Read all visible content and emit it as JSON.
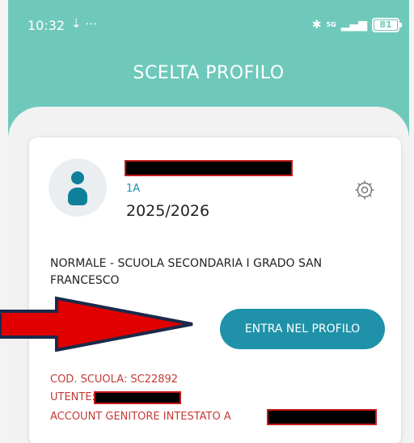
{
  "status_bar": {
    "time": "10:32",
    "network": "5G",
    "battery": "81"
  },
  "header": {
    "title": "SCELTA PROFILO"
  },
  "profile": {
    "class": "1A",
    "year": "2025/2026",
    "school": "NORMALE - SCUOLA SECONDARIA I GRADO SAN FRANCESCO",
    "enter_label": "ENTRA NEL PROFILO",
    "school_code": "COD. SCUOLA: SC22892",
    "user_label": "UTENTE:",
    "account_label": "ACCOUNT GENITORE INTESTATO A"
  },
  "colors": {
    "header": "#6fc9bb",
    "accent": "#1f92a9",
    "info_text": "#c43b37",
    "arrow": "#e00000"
  },
  "icons": {
    "settings": "gear-icon",
    "avatar": "person-icon",
    "annotation": "arrow-right"
  }
}
